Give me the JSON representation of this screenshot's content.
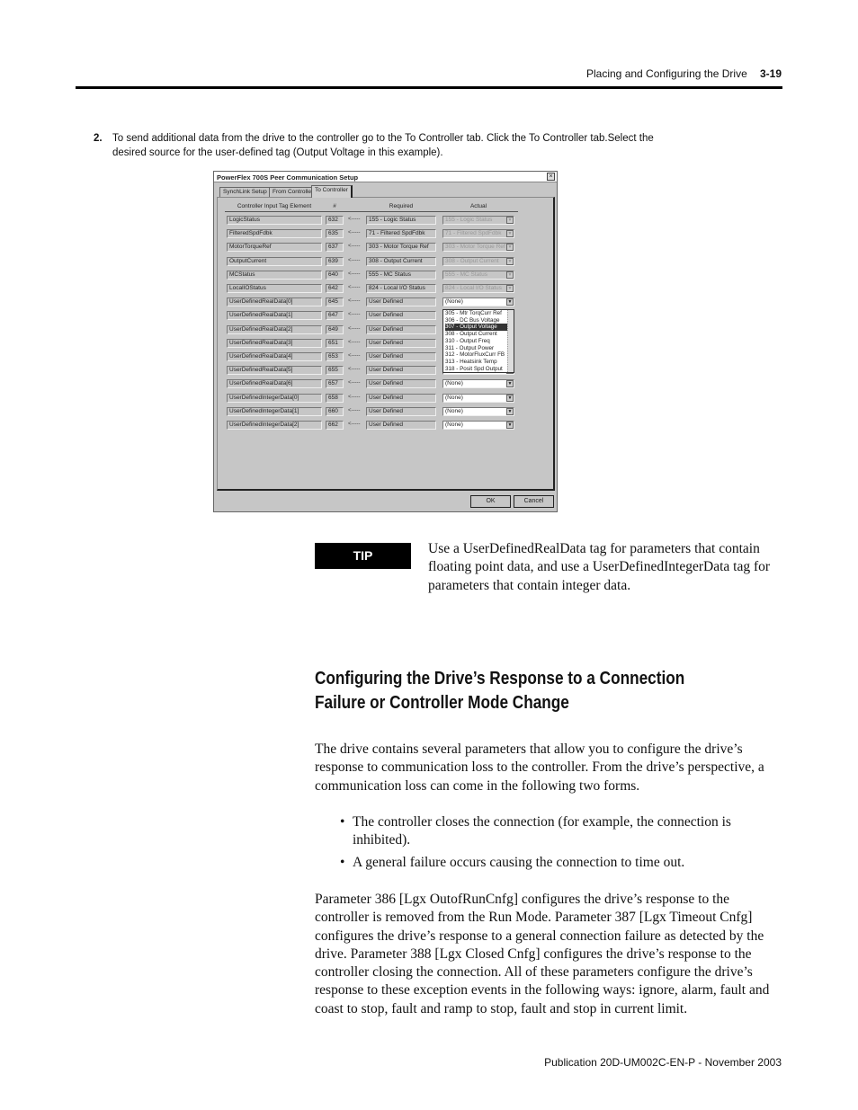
{
  "header": {
    "section": "Placing and Configuring the Drive",
    "page": "3-19"
  },
  "step": {
    "number": "2.",
    "text": "To send additional data from the drive to the controller go to the To Controller tab. Click the To Controller tab.Select the desired source for the user-defined tag (Output Voltage in this example)."
  },
  "dialog": {
    "title": "PowerFlex 700S Peer Communication Setup",
    "close": "×",
    "tabs": [
      "SynchLink Setup",
      "From Controller",
      "To Controller"
    ],
    "active_tab": "To Controller",
    "columns": [
      "Controller Input Tag Element",
      "#",
      "Required",
      "Actual"
    ],
    "arrow": "<-----",
    "rows": [
      {
        "tag": "LogicStatus",
        "num": "632",
        "required": "155 - Logic Status",
        "actual": "155 - Logic Status"
      },
      {
        "tag": "FilteredSpdFdbk",
        "num": "635",
        "required": "71 - Filtered SpdFdbk",
        "actual": "71 - Filtered SpdFdbk"
      },
      {
        "tag": "MotorTorqueRef",
        "num": "637",
        "required": "303 - Motor Torque Ref",
        "actual": "303 - Motor Torque Ref"
      },
      {
        "tag": "OutputCurrent",
        "num": "639",
        "required": "308 - Output Current",
        "actual": "308 - Output Current"
      },
      {
        "tag": "MCStatus",
        "num": "640",
        "required": "555 - MC Status",
        "actual": "555 - MC Status"
      },
      {
        "tag": "LocalIOStatus",
        "num": "642",
        "required": "824 - Local I/O Status",
        "actual": "824 - Local I/O Status"
      },
      {
        "tag": "UserDefinedRealData[0]",
        "num": "645",
        "required": "User Defined",
        "actual": "(None)"
      },
      {
        "tag": "UserDefinedRealData[1]",
        "num": "647",
        "required": "User Defined",
        "actual": ""
      },
      {
        "tag": "UserDefinedRealData[2]",
        "num": "649",
        "required": "User Defined",
        "actual": ""
      },
      {
        "tag": "UserDefinedRealData[3]",
        "num": "651",
        "required": "User Defined",
        "actual": ""
      },
      {
        "tag": "UserDefinedRealData[4]",
        "num": "653",
        "required": "User Defined",
        "actual": ""
      },
      {
        "tag": "UserDefinedRealData[5]",
        "num": "655",
        "required": "User Defined",
        "actual": "(None)"
      },
      {
        "tag": "UserDefinedRealData[6]",
        "num": "657",
        "required": "User Defined",
        "actual": "(None)"
      },
      {
        "tag": "UserDefinedIntegerData[0]",
        "num": "658",
        "required": "User Defined",
        "actual": "(None)"
      },
      {
        "tag": "UserDefinedIntegerData[1]",
        "num": "660",
        "required": "User Defined",
        "actual": "(None)"
      },
      {
        "tag": "UserDefinedIntegerData[2]",
        "num": "662",
        "required": "User Defined",
        "actual": "(None)"
      }
    ],
    "dropdown_list": [
      "305 - Mtr TorqCurr Ref",
      "306 - DC Bus Voltage",
      "307 - Output Voltage",
      "308 - Output Current",
      "310 - Output Freq",
      "311 - Output Power",
      "312 - MotorFluxCurr FB",
      "313 - Heatsink Temp",
      "318 - Posit Spd Output"
    ],
    "dropdown_selected": "307 - Output Voltage",
    "ok": "OK",
    "cancel": "Cancel"
  },
  "tip": {
    "label": "TIP",
    "text": "Use a UserDefinedRealData tag for parameters that contain floating point data, and use a UserDefinedIntegerData tag for parameters that contain integer data."
  },
  "section": {
    "title": "Configuring the Drive’s Response to a Connection Failure or Controller Mode Change",
    "para1": "The drive contains several parameters that allow you to configure the drive’s response to communication loss to the controller. From the drive’s perspective, a communication loss can come in the following two forms.",
    "bullets": [
      "The controller closes the connection (for example, the connection is inhibited).",
      "A general failure occurs causing the connection to time out."
    ],
    "para2": "Parameter 386 [Lgx OutofRunCnfg] configures the drive’s response to the controller is removed from the Run Mode. Parameter 387 [Lgx Timeout Cnfg] configures the drive’s response to a general connection failure as detected by the drive. Parameter 388 [Lgx Closed Cnfg] configures the drive’s response to the controller closing the connection.  All of these parameters configure the drive’s response to these exception events in the following ways: ignore, alarm, fault and coast to stop, fault and ramp to stop, fault and stop in current limit."
  },
  "footer": "Publication 20D-UM002C-EN-P - November 2003"
}
